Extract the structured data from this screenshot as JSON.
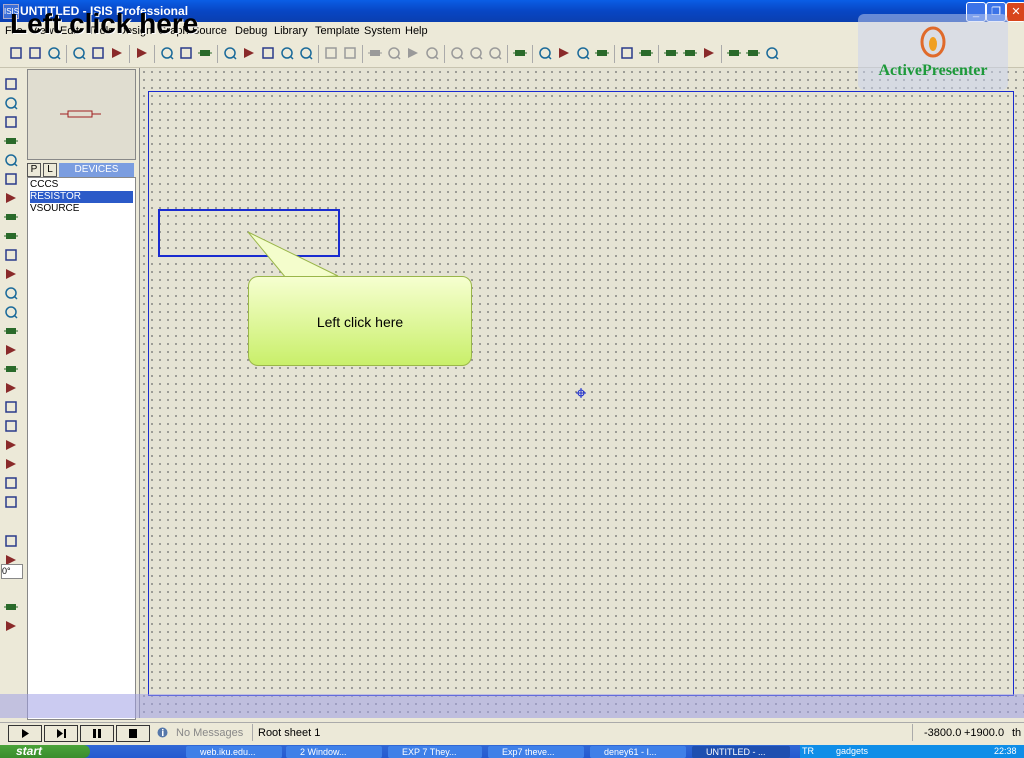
{
  "window": {
    "title": "UNTITLED - ISIS Professional",
    "icon_text": "ISIS"
  },
  "overlay_caption": "Left click here",
  "menu": [
    "File",
    "View",
    "Edit",
    "Tools",
    "Design",
    "Graph",
    "Source",
    "Debug",
    "Library",
    "Template",
    "System",
    "Help"
  ],
  "toolbar_icons": [
    "new-icon",
    "open-icon",
    "save-icon",
    "import-icon",
    "export-icon",
    "print-icon",
    "area-icon",
    "refresh-icon",
    "grid-icon",
    "origin-icon",
    "pan-icon",
    "zoom-in-icon",
    "zoom-out-icon",
    "zoom-all-icon",
    "zoom-area-icon",
    "undo-icon",
    "redo-icon",
    "cut-icon",
    "copy-icon",
    "paste-icon",
    "block-copy-icon",
    "block-move-icon",
    "block-rotate-icon",
    "block-delete-icon",
    "pick-device-icon",
    "make-device-icon",
    "packaging-icon",
    "decompose-icon",
    "wire-autoroute-icon",
    "search-icon",
    "property-tool-icon",
    "new-sheet-icon",
    "remove-sheet-icon",
    "exit-to-parent-icon",
    "bill-of-materials-icon",
    "electrical-rule-check-icon",
    "netlist-icon"
  ],
  "left_tools": [
    "selection-icon",
    "component-icon",
    "junction-icon",
    "wire-label-icon",
    "text-script-icon",
    "bus-icon",
    "subcircuit-icon",
    "terminal-icon",
    "device-pin-icon",
    "graph-icon",
    "tape-recorder-icon",
    "generator-icon",
    "voltage-probe-icon",
    "current-probe-icon",
    "virtual-instrument-icon",
    "line-icon",
    "box-icon",
    "circle-icon",
    "arc-icon",
    "path-icon",
    "text-icon",
    "symbol-icon",
    "marker-icon",
    "rotate-cw-icon",
    "rotate-ccw-icon",
    "mirror-x-icon",
    "mirror-y-icon"
  ],
  "rotation_angle": "0°",
  "devices": {
    "tab_p": "P",
    "tab_l": "L",
    "header": "DEVICES",
    "items": [
      "CCCS",
      "RESISTOR",
      "VSOURCE"
    ],
    "selected_index": 1
  },
  "callout": {
    "text": "Left click here"
  },
  "status": {
    "messages": "No Messages",
    "sheet": "Root sheet 1",
    "coord_x": "-3800.0",
    "coord_y": "+1900.0",
    "unit": "th"
  },
  "taskbar": {
    "start": "start",
    "tasks": [
      "web.iku.edu...",
      "2 Window...",
      "EXP 7 They...",
      "Exp7 theve...",
      "deney61 - I...",
      "UNTITLED - ..."
    ],
    "tray_lang": "TR",
    "tray_gadgets": "gadgets",
    "clock": "22:38"
  },
  "watermark": {
    "text": "ActivePresenter"
  }
}
